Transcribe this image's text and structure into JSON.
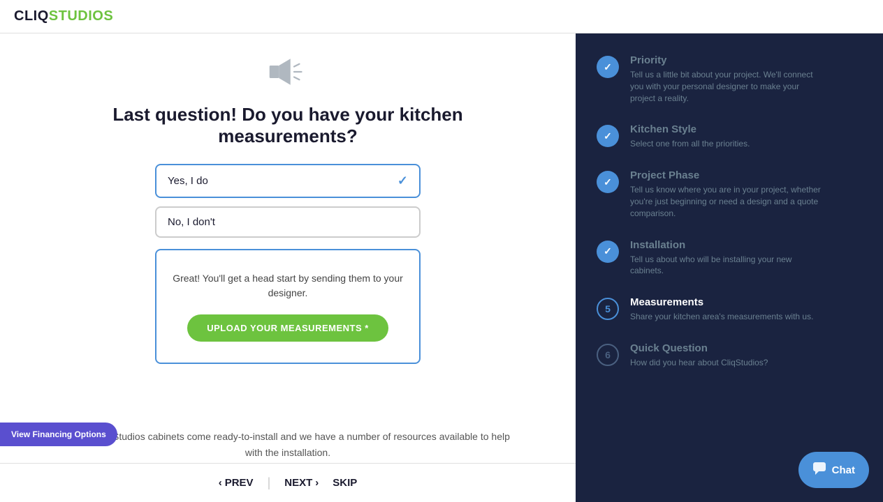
{
  "header": {
    "logo_cliq": "CLIQ",
    "logo_studios": "STUDIOS"
  },
  "main": {
    "icon": "speaker-icon",
    "question": "Last question! Do you have your kitchen measurements?",
    "options": [
      {
        "label": "Yes, I do",
        "selected": true
      },
      {
        "label": "No, I don't",
        "selected": false
      }
    ],
    "upload_box": {
      "description": "Great! You'll get a head start by sending them to your designer.",
      "button_label": "UPLOAD YOUR MEASUREMENTS *"
    },
    "bottom_text": "Great! CliqStudios cabinets come ready-to-install and we have a number of resources available to help with the installation."
  },
  "nav": {
    "prev_label": "PREV",
    "next_label": "NEXT",
    "skip_label": "SKIP"
  },
  "sidebar": {
    "steps": [
      {
        "number": "✓",
        "status": "completed",
        "title": "Priority",
        "title_status": "inactive",
        "description": "Tell us a little bit about your project. We'll connect you with your personal designer to make your project a reality."
      },
      {
        "number": "✓",
        "status": "completed",
        "title": "Kitchen Style",
        "title_status": "inactive",
        "description": "Select one from all the priorities."
      },
      {
        "number": "✓",
        "status": "completed",
        "title": "Project Phase",
        "title_status": "inactive",
        "description": "Tell us know where you are in your project, whether you're just beginning or need a design and a quote comparison."
      },
      {
        "number": "✓",
        "status": "completed",
        "title": "Installation",
        "title_status": "inactive",
        "description": "Tell us about who will be installing your new cabinets."
      },
      {
        "number": "5",
        "status": "active",
        "title": "Measurements",
        "title_status": "active",
        "description": "Share your kitchen area's measurements with us."
      },
      {
        "number": "6",
        "status": "future",
        "title": "Quick Question",
        "title_status": "inactive",
        "description": "How did you hear about CliqStudios?"
      }
    ]
  },
  "financing": {
    "button_label": "View Financing Options"
  },
  "chat": {
    "button_label": "Chat",
    "icon": "chat-icon"
  }
}
